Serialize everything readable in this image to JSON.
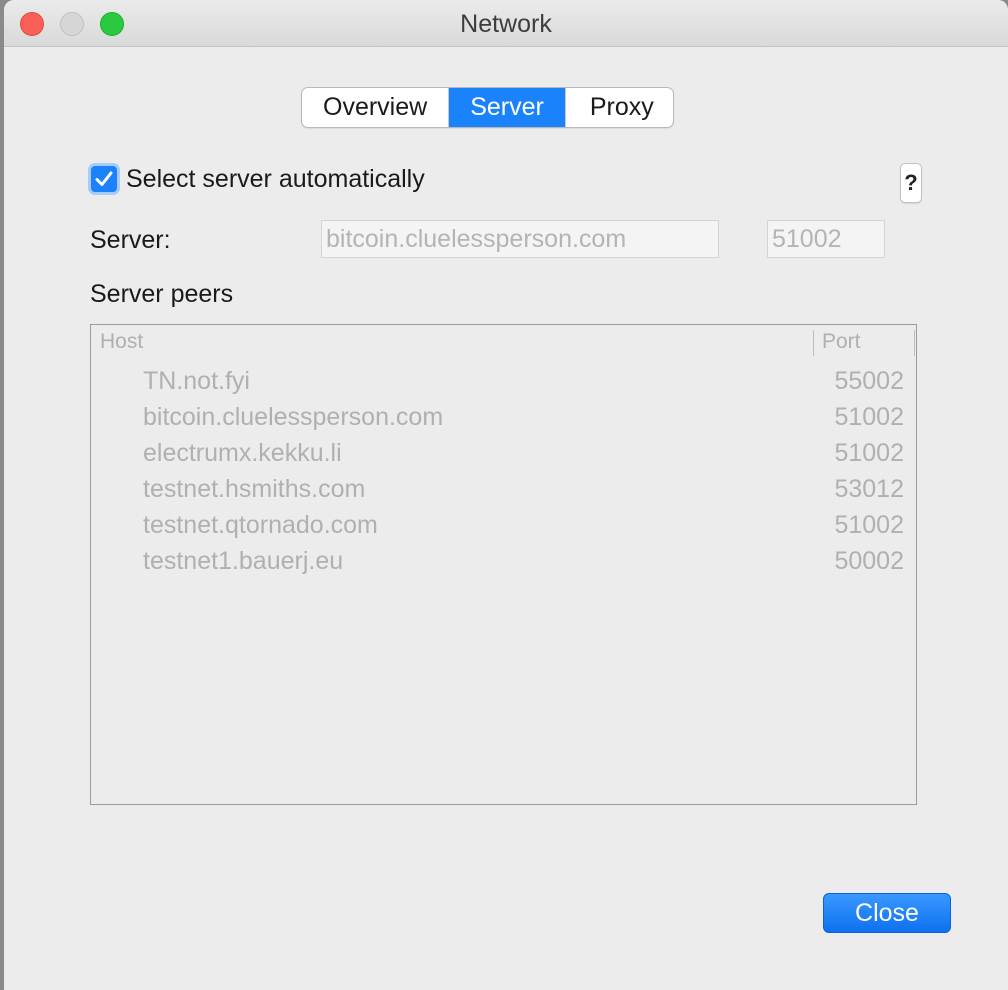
{
  "window": {
    "title": "Network"
  },
  "tabs": [
    {
      "label": "Overview",
      "active": false
    },
    {
      "label": "Server",
      "active": true
    },
    {
      "label": "Proxy",
      "active": false
    }
  ],
  "server": {
    "auto_select_label": "Select server automatically",
    "auto_select_checked": true,
    "help_label": "?",
    "server_label": "Server:",
    "host_value": "bitcoin.cluelessperson.com",
    "port_value": "51002",
    "peers_label": "Server peers"
  },
  "peers_table": {
    "columns": [
      "Host",
      "Port"
    ],
    "rows": [
      {
        "host": "TN.not.fyi",
        "port": "55002"
      },
      {
        "host": "bitcoin.cluelessperson.com",
        "port": "51002"
      },
      {
        "host": "electrumx.kekku.li",
        "port": "51002"
      },
      {
        "host": "testnet.hsmiths.com",
        "port": "53012"
      },
      {
        "host": "testnet.qtornado.com",
        "port": "51002"
      },
      {
        "host": "testnet1.bauerj.eu",
        "port": "50002"
      }
    ]
  },
  "footer": {
    "close_label": "Close"
  },
  "colors": {
    "accent": "#1a83fb",
    "window_bg": "#ececec",
    "disabled_text": "#b0b0b0"
  }
}
